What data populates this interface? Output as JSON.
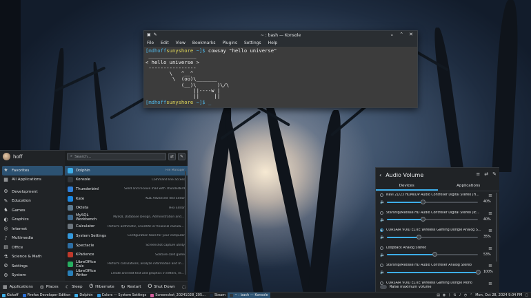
{
  "konsole": {
    "title": "~ : bash — Konsole",
    "menu": [
      "File",
      "Edit",
      "View",
      "Bookmarks",
      "Plugins",
      "Settings",
      "Help"
    ],
    "user": "[mdhoff",
    "host": "sunyshore",
    "prompt_tail": " ~]$ ",
    "command": "cowsay \"hello universe\"",
    "output": " ________________\n< hello universe >\n ----------------\n        \\   ^__^\n         \\  (oo)\\_______\n            (__)\\       )\\/\\\n                ||----w |\n                ||     ||",
    "prompt2_tail": " ~]$ _"
  },
  "kickoff": {
    "username": "hoff",
    "search_placeholder": "Search...",
    "categories": [
      {
        "label": "Favorites",
        "icon": "★"
      },
      {
        "label": "All Applications",
        "icon": "▦"
      },
      {
        "label": "Development",
        "icon": "⚙"
      },
      {
        "label": "Education",
        "icon": "✎"
      },
      {
        "label": "Games",
        "icon": "♞"
      },
      {
        "label": "Graphics",
        "icon": "◐"
      },
      {
        "label": "Internet",
        "icon": "◎"
      },
      {
        "label": "Multimedia",
        "icon": "♪"
      },
      {
        "label": "Office",
        "icon": "▤"
      },
      {
        "label": "Science & Math",
        "icon": "⚗"
      },
      {
        "label": "Settings",
        "icon": "⚙"
      },
      {
        "label": "System",
        "icon": "⚙"
      }
    ],
    "apps": [
      {
        "name": "Dolphin",
        "desc": "File Manager",
        "color": "#3daee9"
      },
      {
        "name": "Konsole",
        "desc": "Command line access",
        "color": "#31363b"
      },
      {
        "name": "Thunderbird",
        "desc": "Send and receive mail with Thunderbird",
        "color": "#2f7fd7"
      },
      {
        "name": "Kate",
        "desc": "KDE Advanced Text Editor",
        "color": "#1b88e3"
      },
      {
        "name": "Okteta",
        "desc": "Hex Editor",
        "color": "#5e7a8f"
      },
      {
        "name": "MySQL Workbench",
        "desc": "MySQL Database Design, Administration and ...",
        "color": "#3f6b8f"
      },
      {
        "name": "Calculator",
        "desc": "Perform arithmetic, scientific or financial calculations",
        "color": "#6c757d"
      },
      {
        "name": "System Settings",
        "desc": "Configuration tools for your computer",
        "color": "#3498db"
      },
      {
        "name": "Spectacle",
        "desc": "Screenshot capture utility",
        "color": "#2d6ea3"
      },
      {
        "name": "KPatience",
        "desc": "Solitaire card game",
        "color": "#c0392b"
      },
      {
        "name": "LibreOffice Calc",
        "desc": "Perform calculations, analyze information and ma...",
        "color": "#27ae60"
      },
      {
        "name": "LibreOffice Writer",
        "desc": "Create and edit text and graphics in letters, rep...",
        "color": "#2980b9"
      }
    ],
    "footer": {
      "applications": "Applications",
      "places": "Places",
      "sleep": "Sleep",
      "hibernate": "Hibernate",
      "restart": "Restart",
      "shutdown": "Shut Down"
    }
  },
  "audio": {
    "title": "Audio Volume",
    "tabs": [
      "Devices",
      "Applications"
    ],
    "devices": [
      {
        "name": "Navi 21/23 HDMI/DP Audio Controller Digital Stereo (H...",
        "percent": "40%",
        "level": 0.4,
        "default": false
      },
      {
        "name": "Starship/Matisse HD Audio Controller Digital Stereo (IE...",
        "percent": "40%",
        "level": 0.4,
        "default": false
      },
      {
        "name": "CORSAIR VOID ELITE Wireless Gaming Dongle Analog S...",
        "percent": "35%",
        "level": 0.35,
        "default": true
      },
      {
        "name": "Loopback Analog Stereo",
        "percent": "53%",
        "level": 0.53,
        "default": false
      },
      {
        "name": "Starship/Matisse HD Audio Controller Analog Stereo",
        "percent": "100%",
        "level": 1.0,
        "default": false
      },
      {
        "name": "CORSAIR VOID ELITE Wireless Gaming Dongle Mono",
        "percent": "",
        "level": 0.0,
        "default": false
      }
    ],
    "raise_label": "Raise maximum volume"
  },
  "taskbar": {
    "tasks": [
      {
        "label": "Kickoff",
        "color": "#3daee9",
        "active": false
      },
      {
        "label": "Firefox Developer Edition",
        "color": "#2a6fd6",
        "active": false
      },
      {
        "label": "Dolphin",
        "color": "#3daee9",
        "active": false
      },
      {
        "label": "Colors — System Settings",
        "color": "#3498db",
        "active": false
      },
      {
        "label": "Screenshot_20241028_205...",
        "color": "#d35d9c",
        "active": false
      },
      {
        "label": "Steam",
        "color": "#1b2838",
        "active": false
      },
      {
        "label": "~ : bash — Konsole",
        "color": "#31363b",
        "active": true
      }
    ],
    "clock": "Mon, Oct 28, 2024 9:04 PM"
  }
}
